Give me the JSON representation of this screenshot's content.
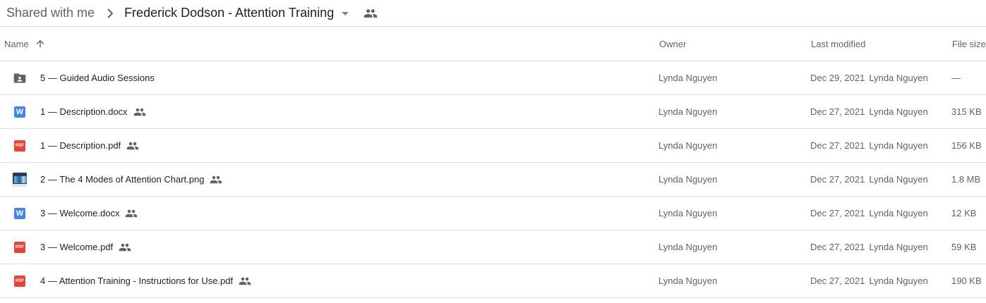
{
  "breadcrumb": {
    "root": "Shared with me",
    "current": "Frederick Dodson - Attention Training"
  },
  "columns": {
    "name": "Name",
    "owner": "Owner",
    "last_modified": "Last modified",
    "file_size": "File size"
  },
  "files": [
    {
      "icon": "shared-folder-icon",
      "name": "5 — Guided Audio Sessions",
      "shared": false,
      "owner": "Lynda Nguyen",
      "modified_date": "Dec 29, 2021",
      "modified_by": "Lynda Nguyen",
      "size": "—"
    },
    {
      "icon": "word-doc-icon",
      "name": "1 — Description.docx",
      "shared": true,
      "owner": "Lynda Nguyen",
      "modified_date": "Dec 27, 2021",
      "modified_by": "Lynda Nguyen",
      "size": "315 KB"
    },
    {
      "icon": "pdf-icon",
      "name": "1 — Description.pdf",
      "shared": true,
      "owner": "Lynda Nguyen",
      "modified_date": "Dec 27, 2021",
      "modified_by": "Lynda Nguyen",
      "size": "156 KB"
    },
    {
      "icon": "image-thumbnail-icon",
      "name": "2 — The 4 Modes of Attention Chart.png",
      "shared": true,
      "owner": "Lynda Nguyen",
      "modified_date": "Dec 27, 2021",
      "modified_by": "Lynda Nguyen",
      "size": "1.8 MB"
    },
    {
      "icon": "word-doc-icon",
      "name": "3 — Welcome.docx",
      "shared": true,
      "owner": "Lynda Nguyen",
      "modified_date": "Dec 27, 2021",
      "modified_by": "Lynda Nguyen",
      "size": "12 KB"
    },
    {
      "icon": "pdf-icon",
      "name": "3 — Welcome.pdf",
      "shared": true,
      "owner": "Lynda Nguyen",
      "modified_date": "Dec 27, 2021",
      "modified_by": "Lynda Nguyen",
      "size": "59 KB"
    },
    {
      "icon": "pdf-icon",
      "name": "4 — Attention Training - Instructions for Use.pdf",
      "shared": true,
      "owner": "Lynda Nguyen",
      "modified_date": "Dec 27, 2021",
      "modified_by": "Lynda Nguyen",
      "size": "190 KB"
    }
  ],
  "icon_labels": {
    "word": "W",
    "pdf": "PDF"
  },
  "colors": {
    "word": "#4285f4",
    "pdf": "#ea4335",
    "folder": "#5f6368",
    "text": "#202124",
    "muted": "#5f6368",
    "divider": "#dadce0"
  }
}
